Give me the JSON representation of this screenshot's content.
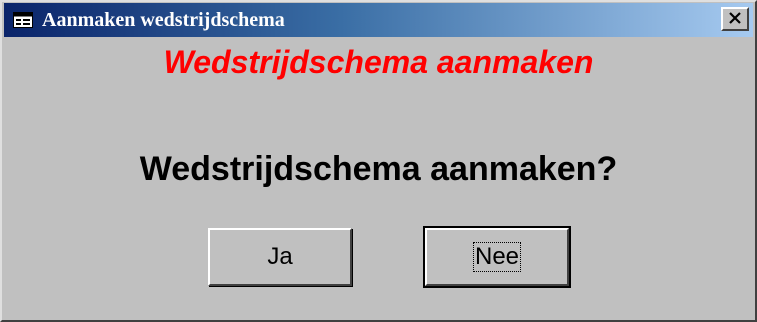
{
  "window": {
    "title": "Aanmaken wedstrijdschema",
    "icon": "form-icon",
    "close_label": "✕"
  },
  "dialog": {
    "heading": "Wedstrijdschema aanmaken",
    "heading_color": "#ff0000",
    "question": "Wedstrijdschema aanmaken?"
  },
  "buttons": {
    "yes_label": "Ja",
    "no_label": "Nee"
  },
  "colors": {
    "titlebar_start": "#0a246a",
    "titlebar_end": "#a6caf0",
    "window_bg": "#c0c0c0"
  }
}
